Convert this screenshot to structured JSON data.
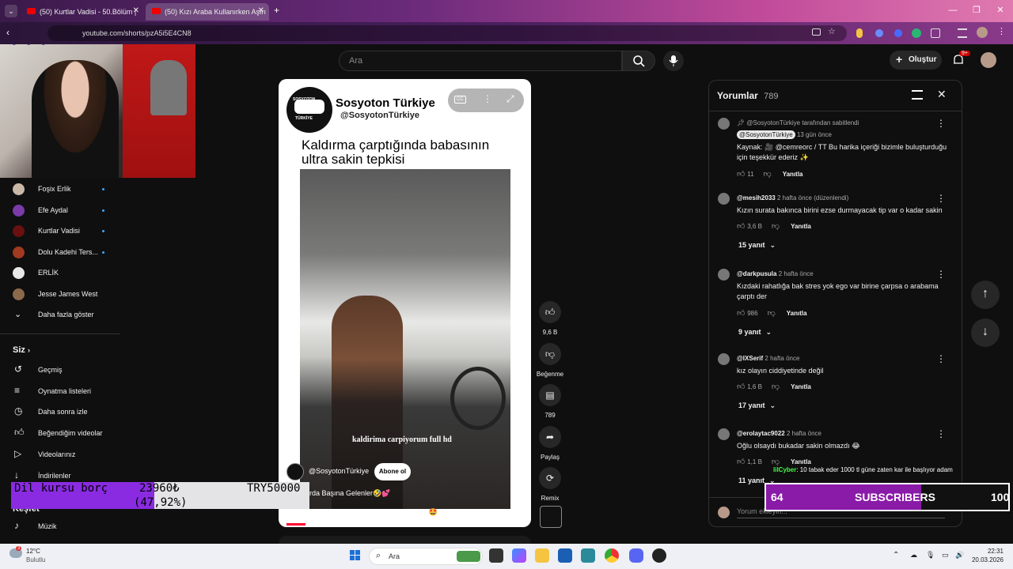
{
  "browser": {
    "tabs": [
      {
        "label": "(50) Kurtlar Vadisi - 50.Bölüm |",
        "active": false
      },
      {
        "label": "(50) Kızı Araba Kullanırken Aşırı",
        "active": true
      }
    ],
    "url": "youtube.com/shorts/pzA5i5E4CN8",
    "new_tab": "+"
  },
  "youtube": {
    "search_placeholder": "Ara",
    "create_label": "Oluştur",
    "notif_badge": "9+"
  },
  "sidebar": {
    "subscriptions": [
      {
        "label": "Foşix Erlik",
        "dot": true,
        "color": "#c9b8a8"
      },
      {
        "label": "Efe Aydal",
        "dot": true,
        "color": "#7a3aa8"
      },
      {
        "label": "Kurtlar Vadisi",
        "dot": true,
        "color": "#6a1010"
      },
      {
        "label": "Dolu Kadehi Ters...",
        "dot": true,
        "color": "#a03a20"
      },
      {
        "label": "ERLİK",
        "dot": false,
        "color": "#e8e8e8"
      },
      {
        "label": "Jesse James West",
        "dot": false,
        "color": "#8a6a4a"
      }
    ],
    "show_more": "Daha fazla göster",
    "you_header": "Siz",
    "you_items": [
      {
        "label": "Geçmiş",
        "icon": "history-icon"
      },
      {
        "label": "Oynatma listeleri",
        "icon": "playlist-icon"
      },
      {
        "label": "Daha sonra izle",
        "icon": "watch-later-icon"
      },
      {
        "label": "Beğendiğim videolar",
        "icon": "thumbs-up-icon"
      },
      {
        "label": "Videolarınız",
        "icon": "video-icon"
      },
      {
        "label": "İndirilenler",
        "icon": "download-icon"
      }
    ],
    "explore_header": "Keşfet",
    "music": "Müzik"
  },
  "short": {
    "channel_name": "Sosyoton Türkiye",
    "channel_handle": "@SosyotonTürkiye",
    "logo_text_top": "SOSYOTON",
    "logo_text_bottom": "TÜRKİYE",
    "title_line1": "Kaldırma çarptığında babasının",
    "title_line2": "ultra sakin tepkisi",
    "caption": "kaldirima carpiyorum full hd",
    "overlay_channel": "@SosyotonTürkiye",
    "subscribe": "Abone ol",
    "desc1": "urda Başına Gelenler🤣💕",
    "desc2": "Kızı Araba Kullanırken Aşırı Sakin Olan Baba🤩",
    "cc": "CC"
  },
  "actions": [
    {
      "label": "9,6 B",
      "icon": "like-icon"
    },
    {
      "label": "Beğenme",
      "icon": "dislike-icon"
    },
    {
      "label": "789",
      "icon": "comment-icon"
    },
    {
      "label": "Paylaş",
      "icon": "share-icon"
    },
    {
      "label": "Remix",
      "icon": "remix-icon"
    }
  ],
  "comments": {
    "header": "Yorumlar",
    "count": "789",
    "items": [
      {
        "pinned": "@SosyotonTürkiye tarafından sabitlendi",
        "author": "@SosyotonTürkiye",
        "time": "13 gün önce",
        "text": "Kaynak: 🎥 @cemreorc / TT Bu harika içeriği bizimle buluşturduğu için teşekkür ederiz ✨",
        "likes": "11",
        "reply": "Yanıtla"
      },
      {
        "author": "@mesih2033",
        "time": "2 hafta önce (düzenlendi)",
        "text": "Kızın surata bakınca birini ezse durmayacak tip var o kadar sakin",
        "likes": "3,6 B",
        "reply": "Yanıtla",
        "replies": "15 yanıt"
      },
      {
        "author": "@darkpusula",
        "time": "2 hafta önce",
        "text": "Kızdaki rahatlığa bak stres yok ego var birine çarpsa o arabama çarptı der",
        "likes": "986",
        "reply": "Yanıtla",
        "replies": "9 yanıt"
      },
      {
        "author": "@IXSerif",
        "time": "2 hafta önce",
        "text": "kız olayın ciddiyetinde değil",
        "likes": "1,6 B",
        "reply": "Yanıtla",
        "replies": "17 yanıt"
      },
      {
        "author": "@erolaytac9022",
        "time": "2 hafta önce",
        "text": "Oğlu olsaydı bukadar sakin olmazdı 😂",
        "likes": "1,1 B",
        "reply": "Yanıtla",
        "replies": "11 yanıt"
      }
    ],
    "input_placeholder": "Yorum ekleyin..."
  },
  "overlays": {
    "donation_label": "Dil kursu borç",
    "donation_amount": "23960₺",
    "donation_goal": "TRY50000",
    "donation_percent": "(47,92%)",
    "donation_fraction": 0.4792,
    "subs_current": "64",
    "subs_label": "SUBSCRIBERS",
    "subs_goal": "100",
    "subs_fraction": 0.64,
    "chat_user": "lilCyber",
    "chat_message": ": 10 tabak eder 1000 tl güne zaten kar ile başlıyor adam"
  },
  "taskbar": {
    "weather_temp": "12°C",
    "weather_desc": "Bulutlu",
    "weather_badge": "3",
    "search": "Ara",
    "time": "22:31",
    "date": "20.03.2026"
  }
}
